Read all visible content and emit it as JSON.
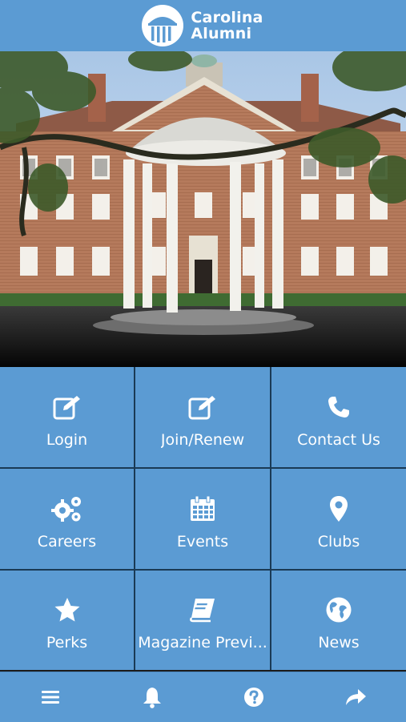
{
  "header": {
    "logo_line1": "Carolina",
    "logo_line2": "Alumni",
    "logo_icon": "old-well-logo-icon"
  },
  "hero": {
    "image": "old-well-campus-photo"
  },
  "menu": [
    {
      "label": "Login",
      "icon": "edit-icon"
    },
    {
      "label": "Join/Renew",
      "icon": "edit-icon"
    },
    {
      "label": "Contact Us",
      "icon": "phone-icon"
    },
    {
      "label": "Careers",
      "icon": "gears-icon"
    },
    {
      "label": "Events",
      "icon": "calendar-icon"
    },
    {
      "label": "Clubs",
      "icon": "map-pin-icon"
    },
    {
      "label": "Perks",
      "icon": "star-icon"
    },
    {
      "label": "Magazine Previ...",
      "icon": "book-icon"
    },
    {
      "label": "News",
      "icon": "globe-icon"
    }
  ],
  "bottom_bar": {
    "items": [
      "menu-icon",
      "bell-icon",
      "help-icon",
      "share-icon"
    ]
  },
  "colors": {
    "primary": "#5b9bd3",
    "tile_divider": "#1a3a55",
    "text": "#ffffff"
  }
}
